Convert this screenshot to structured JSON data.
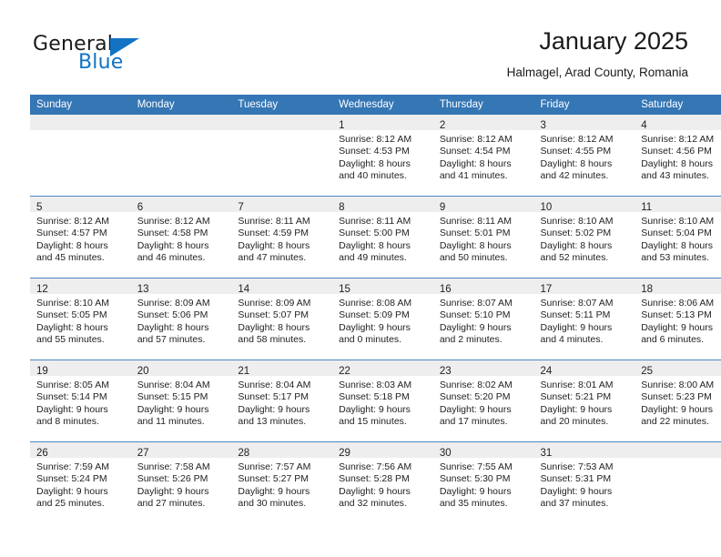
{
  "brand": {
    "name_part1": "General",
    "name_part2": "Blue",
    "accent_color": "#1273c4",
    "logo_icon": "triangle-flag-icon"
  },
  "header": {
    "title": "January 2025",
    "subtitle": "Halmagel, Arad County, Romania"
  },
  "theme": {
    "header_row_bg": "#3576b5",
    "row_divider": "#4a86c5",
    "daynum_band_bg": "#eeeeee",
    "text_color": "#222222"
  },
  "calendar": {
    "weekday_headers": [
      "Sunday",
      "Monday",
      "Tuesday",
      "Wednesday",
      "Thursday",
      "Friday",
      "Saturday"
    ],
    "weeks": [
      [
        {
          "day": "",
          "lines": []
        },
        {
          "day": "",
          "lines": []
        },
        {
          "day": "",
          "lines": []
        },
        {
          "day": "1",
          "lines": [
            "Sunrise: 8:12 AM",
            "Sunset: 4:53 PM",
            "Daylight: 8 hours",
            "and 40 minutes."
          ]
        },
        {
          "day": "2",
          "lines": [
            "Sunrise: 8:12 AM",
            "Sunset: 4:54 PM",
            "Daylight: 8 hours",
            "and 41 minutes."
          ]
        },
        {
          "day": "3",
          "lines": [
            "Sunrise: 8:12 AM",
            "Sunset: 4:55 PM",
            "Daylight: 8 hours",
            "and 42 minutes."
          ]
        },
        {
          "day": "4",
          "lines": [
            "Sunrise: 8:12 AM",
            "Sunset: 4:56 PM",
            "Daylight: 8 hours",
            "and 43 minutes."
          ]
        }
      ],
      [
        {
          "day": "5",
          "lines": [
            "Sunrise: 8:12 AM",
            "Sunset: 4:57 PM",
            "Daylight: 8 hours",
            "and 45 minutes."
          ]
        },
        {
          "day": "6",
          "lines": [
            "Sunrise: 8:12 AM",
            "Sunset: 4:58 PM",
            "Daylight: 8 hours",
            "and 46 minutes."
          ]
        },
        {
          "day": "7",
          "lines": [
            "Sunrise: 8:11 AM",
            "Sunset: 4:59 PM",
            "Daylight: 8 hours",
            "and 47 minutes."
          ]
        },
        {
          "day": "8",
          "lines": [
            "Sunrise: 8:11 AM",
            "Sunset: 5:00 PM",
            "Daylight: 8 hours",
            "and 49 minutes."
          ]
        },
        {
          "day": "9",
          "lines": [
            "Sunrise: 8:11 AM",
            "Sunset: 5:01 PM",
            "Daylight: 8 hours",
            "and 50 minutes."
          ]
        },
        {
          "day": "10",
          "lines": [
            "Sunrise: 8:10 AM",
            "Sunset: 5:02 PM",
            "Daylight: 8 hours",
            "and 52 minutes."
          ]
        },
        {
          "day": "11",
          "lines": [
            "Sunrise: 8:10 AM",
            "Sunset: 5:04 PM",
            "Daylight: 8 hours",
            "and 53 minutes."
          ]
        }
      ],
      [
        {
          "day": "12",
          "lines": [
            "Sunrise: 8:10 AM",
            "Sunset: 5:05 PM",
            "Daylight: 8 hours",
            "and 55 minutes."
          ]
        },
        {
          "day": "13",
          "lines": [
            "Sunrise: 8:09 AM",
            "Sunset: 5:06 PM",
            "Daylight: 8 hours",
            "and 57 minutes."
          ]
        },
        {
          "day": "14",
          "lines": [
            "Sunrise: 8:09 AM",
            "Sunset: 5:07 PM",
            "Daylight: 8 hours",
            "and 58 minutes."
          ]
        },
        {
          "day": "15",
          "lines": [
            "Sunrise: 8:08 AM",
            "Sunset: 5:09 PM",
            "Daylight: 9 hours",
            "and 0 minutes."
          ]
        },
        {
          "day": "16",
          "lines": [
            "Sunrise: 8:07 AM",
            "Sunset: 5:10 PM",
            "Daylight: 9 hours",
            "and 2 minutes."
          ]
        },
        {
          "day": "17",
          "lines": [
            "Sunrise: 8:07 AM",
            "Sunset: 5:11 PM",
            "Daylight: 9 hours",
            "and 4 minutes."
          ]
        },
        {
          "day": "18",
          "lines": [
            "Sunrise: 8:06 AM",
            "Sunset: 5:13 PM",
            "Daylight: 9 hours",
            "and 6 minutes."
          ]
        }
      ],
      [
        {
          "day": "19",
          "lines": [
            "Sunrise: 8:05 AM",
            "Sunset: 5:14 PM",
            "Daylight: 9 hours",
            "and 8 minutes."
          ]
        },
        {
          "day": "20",
          "lines": [
            "Sunrise: 8:04 AM",
            "Sunset: 5:15 PM",
            "Daylight: 9 hours",
            "and 11 minutes."
          ]
        },
        {
          "day": "21",
          "lines": [
            "Sunrise: 8:04 AM",
            "Sunset: 5:17 PM",
            "Daylight: 9 hours",
            "and 13 minutes."
          ]
        },
        {
          "day": "22",
          "lines": [
            "Sunrise: 8:03 AM",
            "Sunset: 5:18 PM",
            "Daylight: 9 hours",
            "and 15 minutes."
          ]
        },
        {
          "day": "23",
          "lines": [
            "Sunrise: 8:02 AM",
            "Sunset: 5:20 PM",
            "Daylight: 9 hours",
            "and 17 minutes."
          ]
        },
        {
          "day": "24",
          "lines": [
            "Sunrise: 8:01 AM",
            "Sunset: 5:21 PM",
            "Daylight: 9 hours",
            "and 20 minutes."
          ]
        },
        {
          "day": "25",
          "lines": [
            "Sunrise: 8:00 AM",
            "Sunset: 5:23 PM",
            "Daylight: 9 hours",
            "and 22 minutes."
          ]
        }
      ],
      [
        {
          "day": "26",
          "lines": [
            "Sunrise: 7:59 AM",
            "Sunset: 5:24 PM",
            "Daylight: 9 hours",
            "and 25 minutes."
          ]
        },
        {
          "day": "27",
          "lines": [
            "Sunrise: 7:58 AM",
            "Sunset: 5:26 PM",
            "Daylight: 9 hours",
            "and 27 minutes."
          ]
        },
        {
          "day": "28",
          "lines": [
            "Sunrise: 7:57 AM",
            "Sunset: 5:27 PM",
            "Daylight: 9 hours",
            "and 30 minutes."
          ]
        },
        {
          "day": "29",
          "lines": [
            "Sunrise: 7:56 AM",
            "Sunset: 5:28 PM",
            "Daylight: 9 hours",
            "and 32 minutes."
          ]
        },
        {
          "day": "30",
          "lines": [
            "Sunrise: 7:55 AM",
            "Sunset: 5:30 PM",
            "Daylight: 9 hours",
            "and 35 minutes."
          ]
        },
        {
          "day": "31",
          "lines": [
            "Sunrise: 7:53 AM",
            "Sunset: 5:31 PM",
            "Daylight: 9 hours",
            "and 37 minutes."
          ]
        },
        {
          "day": "",
          "lines": []
        }
      ]
    ]
  }
}
